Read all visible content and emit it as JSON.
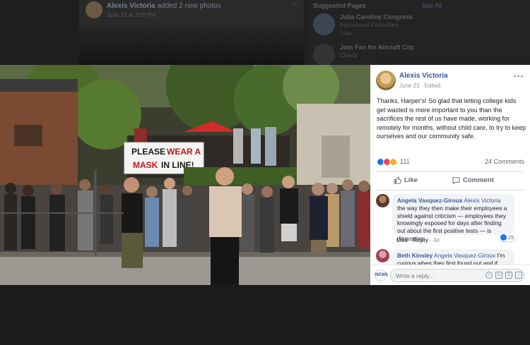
{
  "background_feed": {
    "post_author": "Alexis Victoria",
    "post_action": "added 2 new photos",
    "post_date": "June 23 at 3:58 PM",
    "sidebar_title": "Suggested Pages",
    "sidebar_see_all": "See All",
    "suggested_1_name": "Julia Caroline Congress",
    "suggested_1_sub": "Educational Consultant",
    "suggested_1_like": "Like",
    "suggested_2_name": "Join Fan for Aircraft City",
    "suggested_2_sub": "Charity"
  },
  "photo": {
    "sign_line1_a": "PLEASE",
    "sign_line1_b": "WEAR A",
    "sign_line2_a": "MASK",
    "sign_line2_b": "IN LINE!"
  },
  "post": {
    "author": "Alexis Victoria",
    "date": "June 23 · Edited",
    "more": "···",
    "text": "Thanks, Harper's! So glad that letting college kids get wasted is more important to you than the sacrifices the rest of us have made, working for remotely for months, without child care, to try to keep ourselves and our community safe.",
    "reaction_count": "111",
    "comment_count": "24 Comments",
    "like_label": "Like",
    "comment_label": "Comment"
  },
  "comments": [
    {
      "author": "Angela Vasquez-Giroux",
      "mention": "Alexis Victoria",
      "text": "the way they then make their employees a shield against criticism — employees they knowingly exposed for days after finding out about the first positive tests — is disgusting.",
      "like": "Like",
      "reply": "Reply",
      "time": "4d",
      "likes": "25"
    },
    {
      "author": "Beth Kinsley",
      "mention": "Angela Vasquez-Giroux",
      "text": "I'm curious when they first found out and if they"
    }
  ],
  "reply_box": {
    "avatar_text": "NEWS",
    "placeholder": "Write a reply..."
  },
  "colors": {
    "link": "#385898",
    "sign_red": "#c4161c",
    "like_blue": "#1877f2",
    "love_red": "#f33e58",
    "wow_yellow": "#f7b125"
  }
}
